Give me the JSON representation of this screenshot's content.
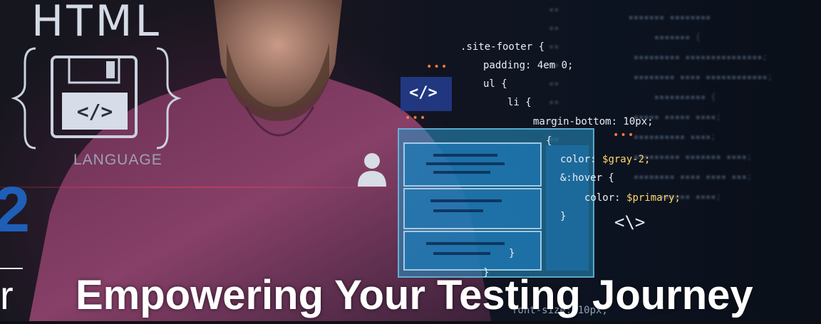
{
  "logo": {
    "html_text": "HTML",
    "language_text": "LANGUAGE",
    "icon": "floppy-disk-code-icon"
  },
  "left_fragment": {
    "number": "2",
    "letter": "r"
  },
  "code_snippet": {
    "line1": ".site-footer {",
    "line2": "padding: 4em 0;",
    "line3": "ul {",
    "line4": "li {",
    "line5": "margin-bottom: 10px;",
    "line6": "{",
    "line7_prefix": "color: ",
    "line7_value": "$gray-2;",
    "line8": "&:hover {",
    "line9_prefix": "color: ",
    "line9_value": "$primary;",
    "line10": "}",
    "line11": "}",
    "line12": "}",
    "line13": "font-size: 10px;"
  },
  "dots": "•••",
  "tags": {
    "box_tag": "</>",
    "floating_tag": "<\\>"
  },
  "headline": "Empowering Your Testing Journey",
  "colors": {
    "headline": "#ffffff",
    "accent_blue": "#1f5fb8",
    "dots_orange": "#ff7a3c",
    "panel_cyan": "#2896c8"
  }
}
